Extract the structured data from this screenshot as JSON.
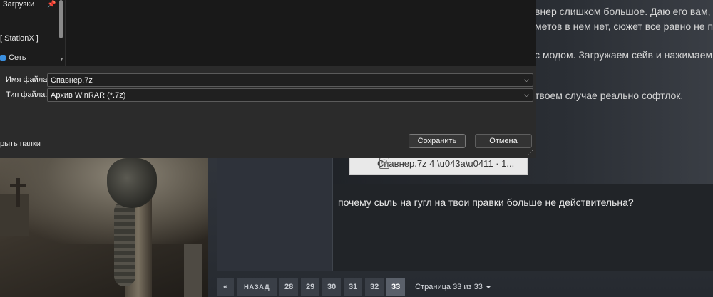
{
  "post": {
    "line1": "внер слишком большое. Даю его вам, б",
    "line2": "метов в нем нет, сюжет все равно не по",
    "line3": "с модом. Загружаем сейв и нажимаем I",
    "line4": "твоем случае реально софтлок.",
    "attachment": "Спавнер.7z 4 \\u043a\\u0411 · 1...",
    "reply": "почему сыль на гугл на твои правки больше не действительна?"
  },
  "pager": {
    "prev_icon": "«",
    "back_label": "НАЗАД",
    "pages": [
      "28",
      "29",
      "30",
      "31",
      "32"
    ],
    "current": "33",
    "info": "Страница 33 из 33"
  },
  "dialog": {
    "nav": {
      "downloads": "Загрузки",
      "pin": "📌",
      "stationx": "[ StationX ]",
      "network": "Сеть"
    },
    "filename_label": "Имя файла:",
    "filename_value": "Спавнер.7z",
    "filetype_label": "Тип файла:",
    "filetype_value": "Архив WinRAR (*.7z)",
    "hide_folders": "рыть папки",
    "save_button": "Сохранить",
    "cancel_button": "Отмена"
  },
  "colors": {
    "network_icon": "#3a8fe0",
    "active_page": "#5a606a"
  }
}
